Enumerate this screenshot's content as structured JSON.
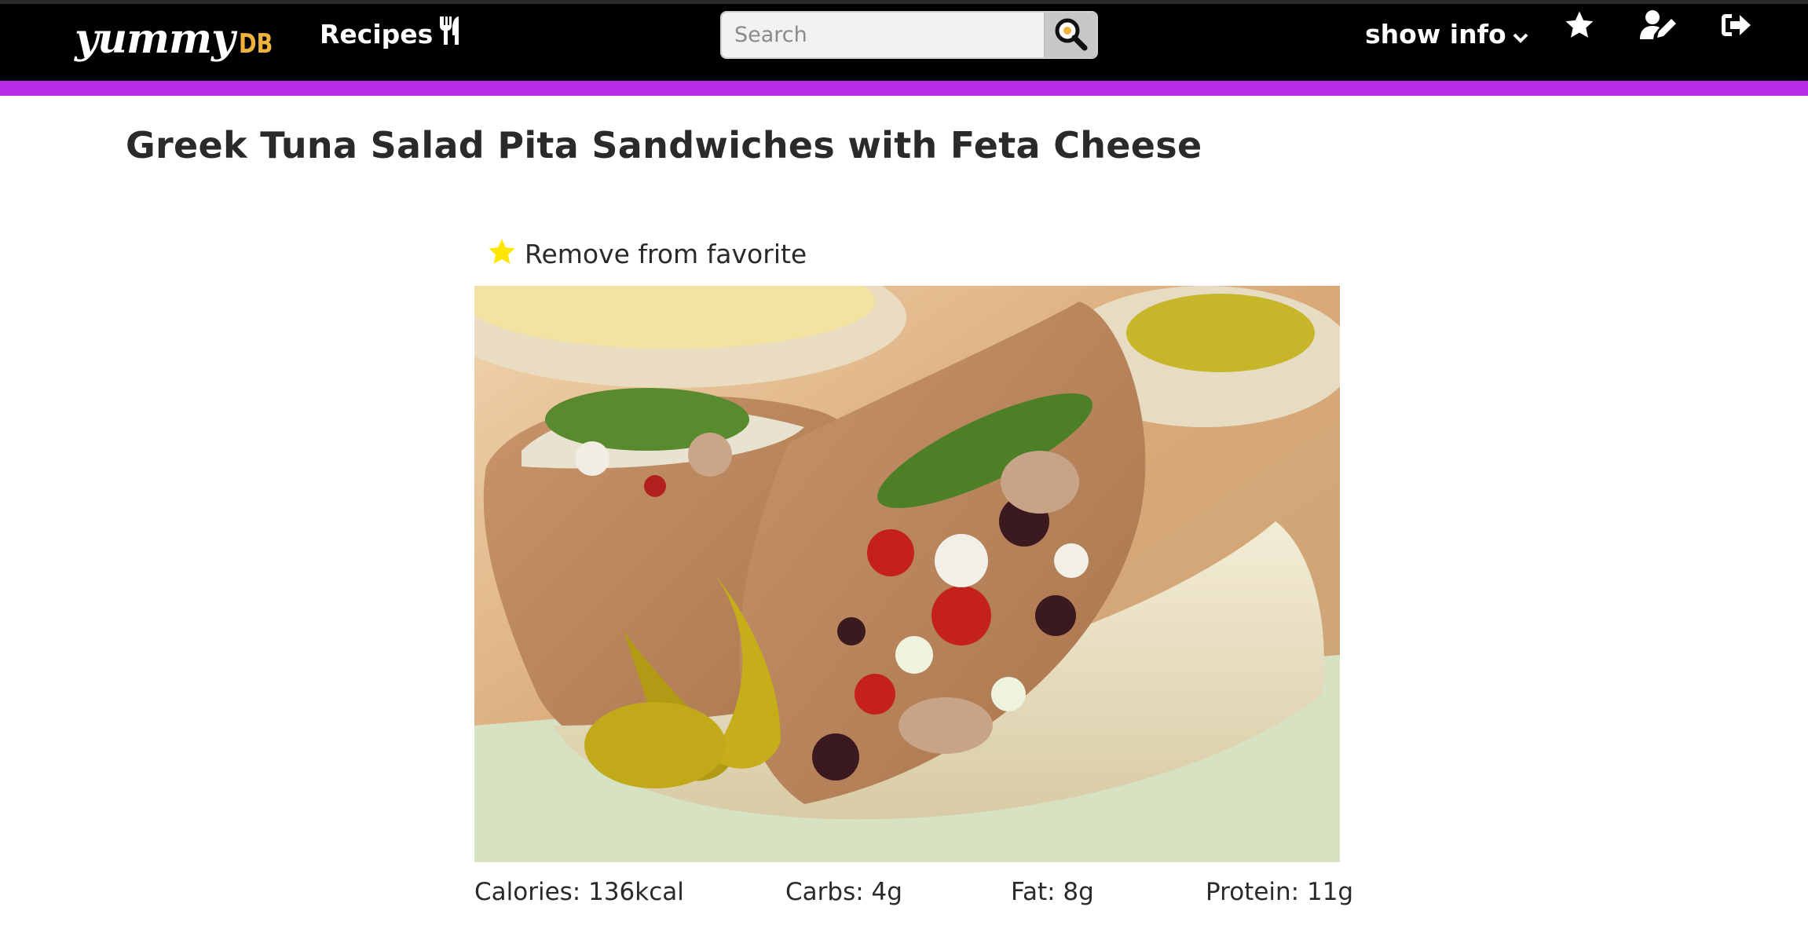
{
  "brand": {
    "logo_main": "yummy",
    "logo_sub": "DB"
  },
  "nav": {
    "recipes_label": "Recipes",
    "search_placeholder": "Search",
    "show_info_label": "show info"
  },
  "icons": {
    "recipes": "fork-knife-icon",
    "search": "magnifier-icon",
    "show_info": "chevron-down-icon",
    "favorites": "star-icon",
    "edit_profile": "user-edit-icon",
    "logout": "sign-out-icon",
    "favorite_status": "star-icon"
  },
  "colors": {
    "topbar": "#000000",
    "accent": "#b62be6",
    "logo_sub": "#f0b23c",
    "favorite_star": "#ffe600"
  },
  "recipe": {
    "title": "Greek Tuna Salad Pita Sandwiches with Feta Cheese",
    "favorite_action": "Remove from favorite",
    "nutrition": {
      "calories": "Calories: 136kcal",
      "carbs": "Carbs: 4g",
      "fat": "Fat: 8g",
      "protein": "Protein: 11g"
    }
  }
}
